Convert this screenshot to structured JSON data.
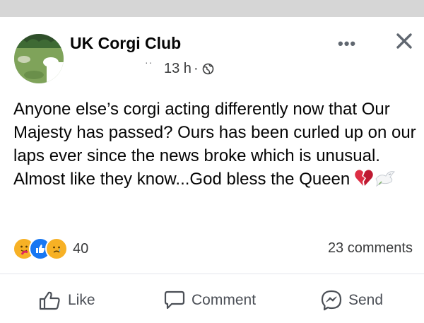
{
  "post": {
    "group_name": "UK Corgi Club",
    "timestamp": "13 h",
    "separator": "·",
    "header_mark": "··",
    "more_label": "•••",
    "text": "Anyone else’s corgi acting differently now that Our Majesty has passed? Ours has been curled up on our laps ever since the news broke which is unusual. Almost like they know...God bless the Queen",
    "text_emojis": [
      "broken-heart",
      "dove"
    ]
  },
  "engagement": {
    "reaction_icons": [
      "care-reaction",
      "like-reaction",
      "sad-reaction"
    ],
    "reaction_count": "40",
    "comments_label": "23 comments"
  },
  "actions": {
    "like": "Like",
    "comment": "Comment",
    "send": "Send"
  },
  "colors": {
    "like_blue": "#1877f2",
    "reaction_yellow": "#f7b125",
    "heart_red": "#dd2e44",
    "text_dark": "#050505",
    "text_muted": "#65676b"
  }
}
